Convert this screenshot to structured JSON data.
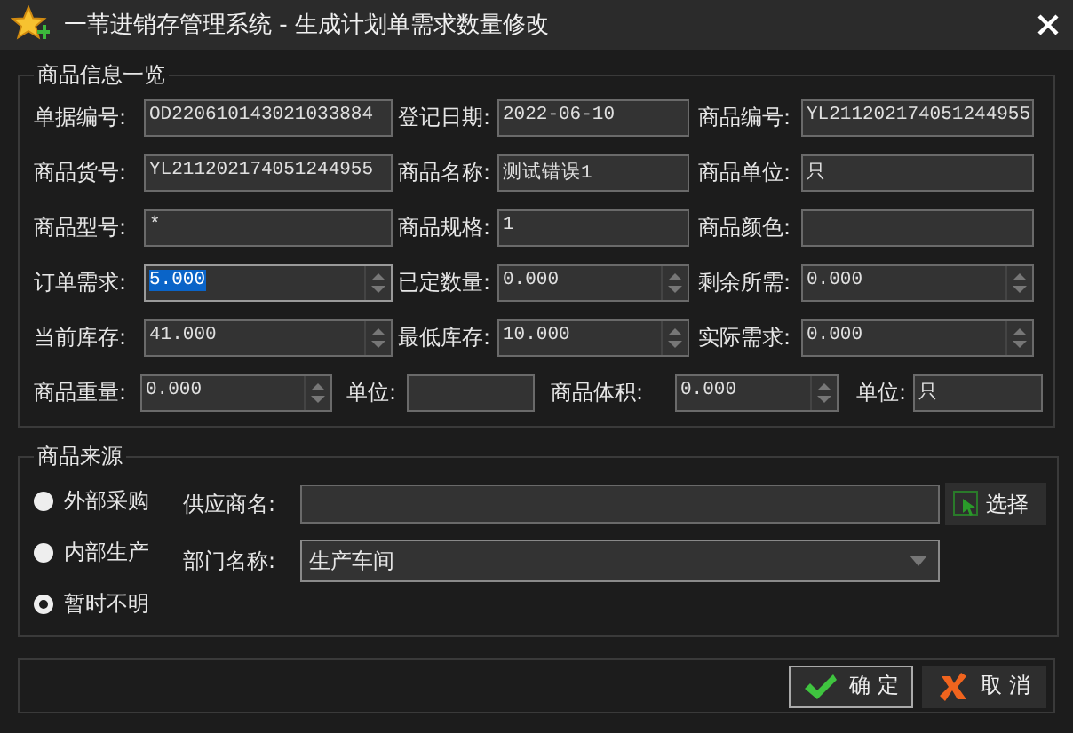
{
  "window": {
    "title": "一苇进销存管理系统 - 生成计划单需求数量修改"
  },
  "info_group": {
    "title": "商品信息一览",
    "rows": [
      [
        {
          "label": "单据编号:",
          "value": "OD220610143021033884",
          "kind": "text",
          "selected": false
        },
        {
          "label": "登记日期:",
          "value": "2022-06-10",
          "kind": "text",
          "selected": false
        },
        {
          "label": "商品编号:",
          "value": "YL211202174051244955",
          "kind": "text",
          "selected": false
        }
      ],
      [
        {
          "label": "商品货号:",
          "value": "YL211202174051244955",
          "kind": "text",
          "selected": false
        },
        {
          "label": "商品名称:",
          "value": "测试错误1",
          "kind": "text",
          "selected": false
        },
        {
          "label": "商品单位:",
          "value": "只",
          "kind": "text",
          "selected": false
        }
      ],
      [
        {
          "label": "商品型号:",
          "value": "*",
          "kind": "text",
          "selected": false
        },
        {
          "label": "商品规格:",
          "value": "1",
          "kind": "text",
          "selected": false
        },
        {
          "label": "商品颜色:",
          "kind": "text",
          "selected": false
        }
      ],
      [
        {
          "label": "订单需求:",
          "value": "5.000",
          "kind": "spin",
          "selected": true
        },
        {
          "label": "已定数量:",
          "value": "0.000",
          "kind": "spin",
          "selected": false
        },
        {
          "label": "剩余所需:",
          "value": "0.000",
          "kind": "spin",
          "selected": false
        }
      ],
      [
        {
          "label": "当前库存:",
          "value": "41.000",
          "kind": "spin",
          "selected": false
        },
        {
          "label": "最低库存:",
          "value": "10.000",
          "kind": "spin",
          "selected": false
        },
        {
          "label": "实际需求:",
          "value": "0.000",
          "kind": "spin",
          "selected": false
        }
      ],
      [
        {
          "label": "商品重量:",
          "value": "0.000",
          "kind": "spin",
          "selected": false
        },
        {
          "label": "单位:",
          "kind": "text",
          "selected": false
        },
        {
          "label": "商品体积:",
          "value": "0.000",
          "kind": "spin",
          "selected": false
        },
        {
          "label": "单位:",
          "value": "只",
          "kind": "text",
          "selected": false
        }
      ]
    ]
  },
  "source_group": {
    "title": "商品来源",
    "options": [
      {
        "label": "外部采购",
        "selected": false
      },
      {
        "label": "内部生产",
        "selected": false
      },
      {
        "label": "暂时不明",
        "selected": true
      }
    ],
    "supplier": {
      "label": "供应商名:"
    },
    "select_button": "选择",
    "department": {
      "label": "部门名称:",
      "value": "生产车间"
    }
  },
  "buttons": [
    {
      "label": "确 定",
      "kind": "ok"
    },
    {
      "label": "取 消",
      "kind": "cancel"
    }
  ]
}
